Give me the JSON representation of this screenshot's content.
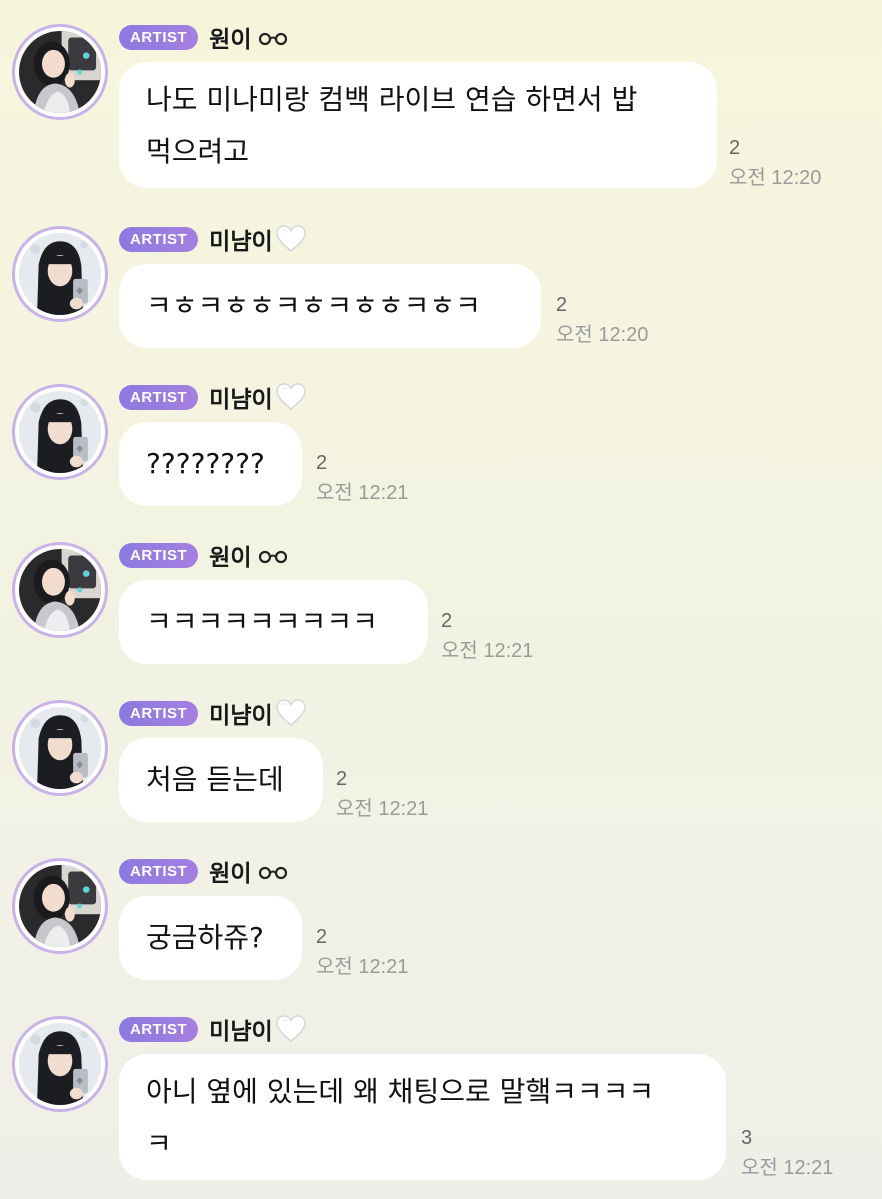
{
  "messages": [
    {
      "badge": "ARTIST",
      "author": "원이",
      "author_icon": "glasses-icon",
      "text": "나도 미나미랑 컴백 라이브 연습 하면서 밥 먹으려고",
      "line1": "나도 미나미랑 컴백 라이브 연습 하면서 밥",
      "line2": "먹으려고",
      "unread": "2",
      "time": "오전 12:20"
    },
    {
      "badge": "ARTIST",
      "author": "미냠이",
      "author_icon": "white-heart-icon",
      "text": "ㅋㅎㅋㅎㅎㅋㅎㅋㅎㅎㅋㅎㅋ",
      "unread": "2",
      "time": "오전 12:20"
    },
    {
      "badge": "ARTIST",
      "author": "미냠이",
      "author_icon": "white-heart-icon",
      "text": "????????",
      "unread": "2",
      "time": "오전 12:21"
    },
    {
      "badge": "ARTIST",
      "author": "원이",
      "author_icon": "glasses-icon",
      "text": "ㅋㅋㅋㅋㅋㅋㅋㅋㅋ",
      "unread": "2",
      "time": "오전 12:21"
    },
    {
      "badge": "ARTIST",
      "author": "미냠이",
      "author_icon": "white-heart-icon",
      "text": "처음 듣는데",
      "unread": "2",
      "time": "오전 12:21"
    },
    {
      "badge": "ARTIST",
      "author": "원이",
      "author_icon": "glasses-icon",
      "text": "궁금하쥬?",
      "unread": "2",
      "time": "오전 12:21"
    },
    {
      "badge": "ARTIST",
      "author": "미냠이",
      "author_icon": "white-heart-icon",
      "text": "아니 옆에 있는데 왜 채팅으로 말햌ㅋㅋㅋㅋ ㅋ",
      "line1": "아니 옆에 있는데 왜 채팅으로 말햌ㅋㅋㅋㅋ",
      "line2": "ㅋ",
      "unread": "3",
      "time": "오전 12:21"
    }
  ],
  "colors": {
    "badge_gradient_start": "#8b7ae0",
    "badge_gradient_end": "#a67fe0",
    "avatar_ring": "#c9b2e8",
    "bubble": "#ffffff",
    "background_top": "#f6f5dc",
    "background_bottom": "#efefe9"
  }
}
